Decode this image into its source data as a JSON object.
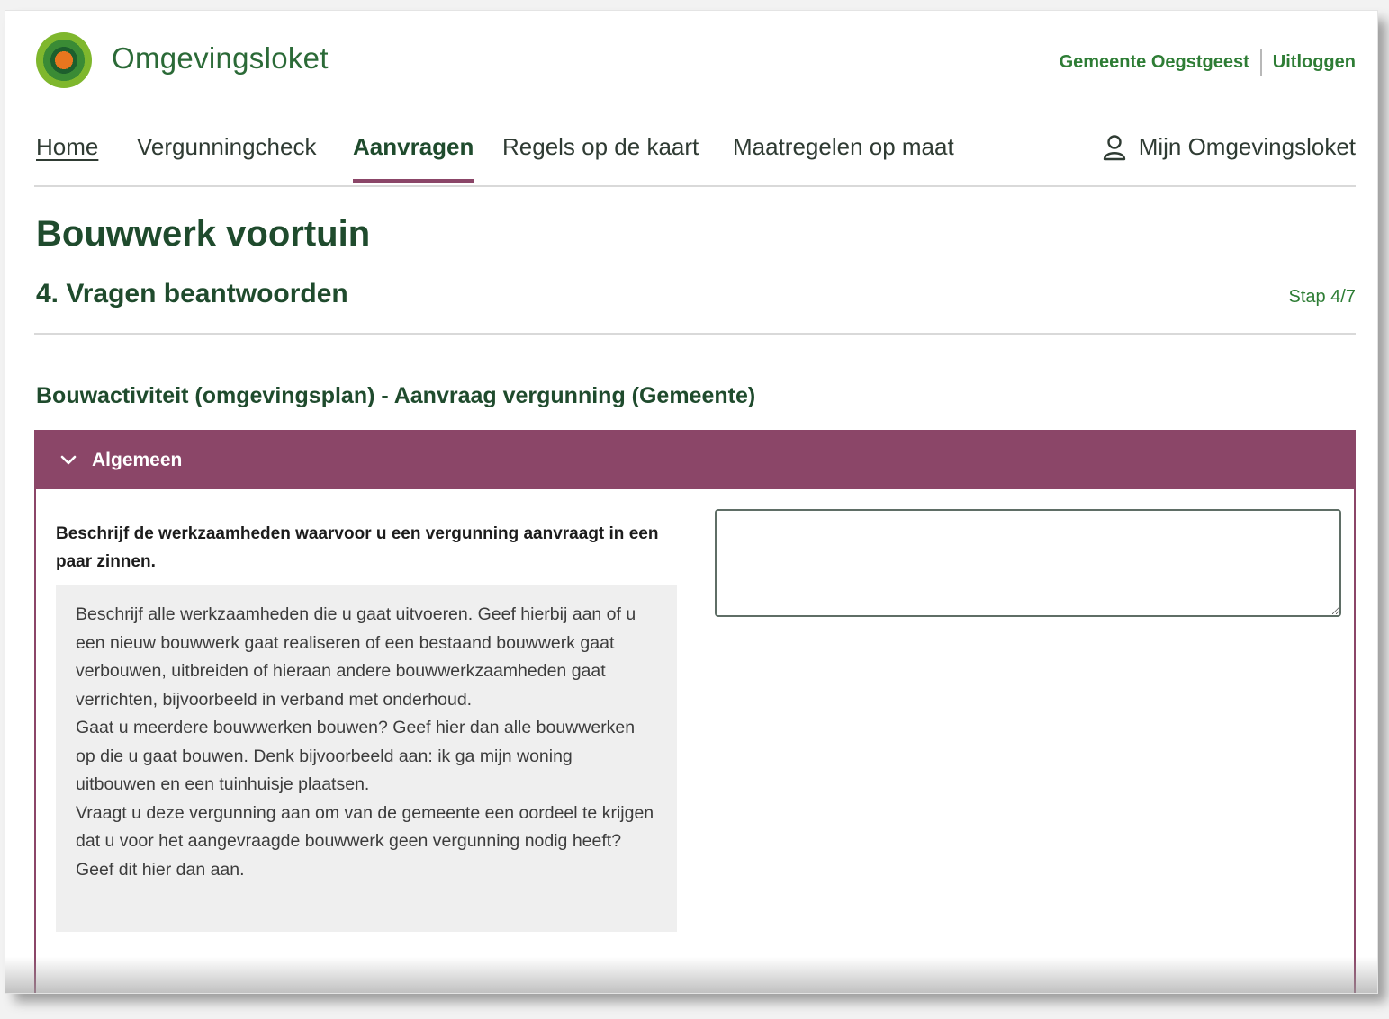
{
  "header": {
    "brand": "Omgevingsloket",
    "municipality": "Gemeente Oegstgeest",
    "logout": "Uitloggen"
  },
  "nav": {
    "items": [
      {
        "label": "Home"
      },
      {
        "label": "Vergunningcheck"
      },
      {
        "label": "Aanvragen"
      },
      {
        "label": "Regels op de kaart"
      },
      {
        "label": "Maatregelen op maat"
      }
    ],
    "active_item": "Aanvragen",
    "account": "Mijn Omgevingsloket"
  },
  "page": {
    "title": "Bouwwerk voortuin",
    "step_heading": "4. Vragen beantwoorden",
    "step_count": "Stap 4/7",
    "activity_heading": "Bouwactiviteit (omgevingsplan) - Aanvraag vergunning (Gemeente)"
  },
  "section": {
    "title": "Algemeen",
    "expanded": true,
    "question": "Beschrijf de werkzaamheden waarvoor u een vergunning aanvraagt in een paar zinnen.",
    "help": [
      "Beschrijf alle werkzaamheden die u gaat uitvoeren. Geef hierbij aan of u een nieuw bouwwerk gaat realiseren of een bestaand bouwwerk gaat verbouwen, uitbreiden of hieraan andere bouwwerkzaamheden gaat verrichten, bijvoorbeeld in verband met onderhoud.",
      "Gaat u meerdere bouwwerken bouwen? Geef hier dan alle bouwwerken op die u gaat bouwen. Denk bijvoorbeeld aan: ik ga mijn woning uitbouwen en een tuinhuisje plaatsen.",
      "Vraagt u deze vergunning aan om van de gemeente een oordeel te krijgen dat u voor het aangevraagde bouwwerk geen vergunning nodig heeft? Geef dit hier dan aan."
    ],
    "answer_value": ""
  },
  "colors": {
    "primary_green": "#1f4b2d",
    "link_green": "#2e7d35",
    "accent_purple": "#8b4668",
    "help_background": "#efefef"
  },
  "icons": {
    "logo": "omgevingsloket-logo-icon",
    "account": "user-icon",
    "section_toggle": "chevron-down-icon"
  }
}
